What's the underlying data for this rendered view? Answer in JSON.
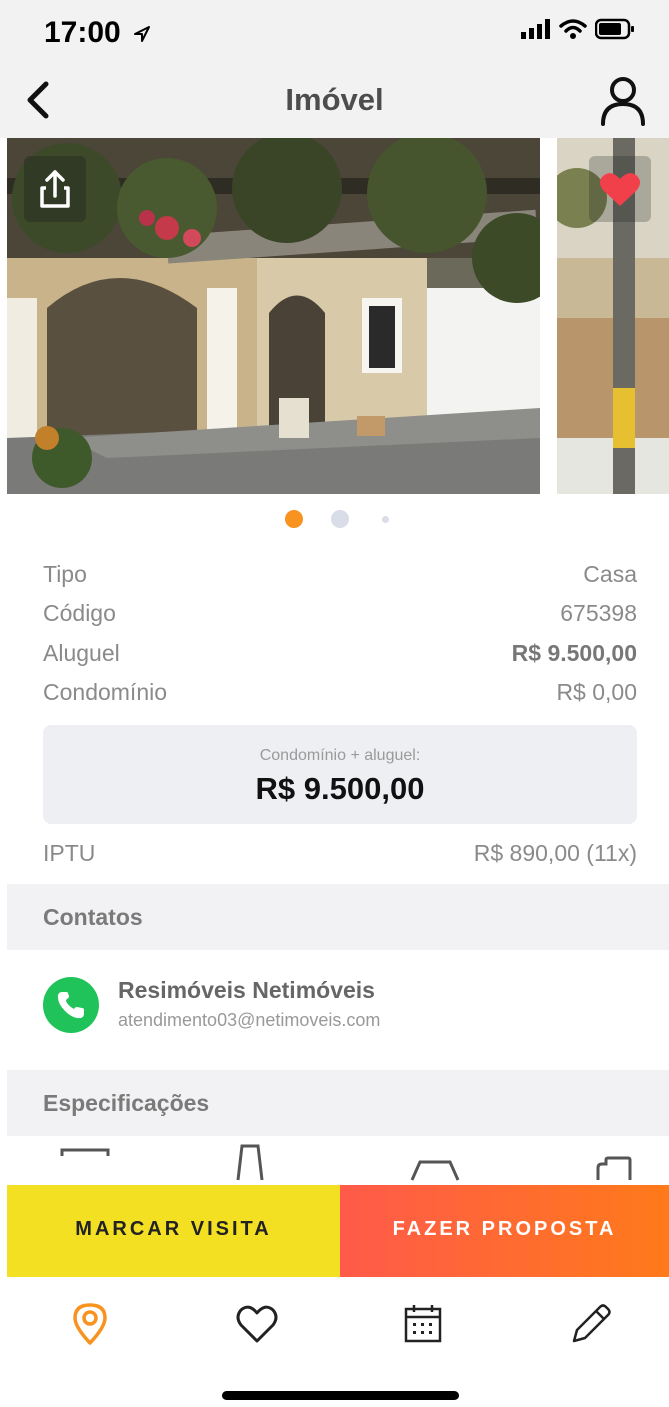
{
  "status_bar": {
    "time": "17:00"
  },
  "nav": {
    "title": "Imóvel"
  },
  "gallery": {
    "dots_count": 3,
    "active_dot": 0
  },
  "details": {
    "rows": [
      {
        "label": "Tipo",
        "value": "Casa",
        "bold": false
      },
      {
        "label": "Código",
        "value": "675398",
        "bold": false
      },
      {
        "label": "Aluguel",
        "value": "R$ 9.500,00",
        "bold": true
      },
      {
        "label": "Condomínio",
        "value": "R$ 0,00",
        "bold": false
      }
    ],
    "total_label": "Condomínio + aluguel:",
    "total_value": "R$ 9.500,00",
    "iptu_label": "IPTU",
    "iptu_value": "R$ 890,00 (11x)"
  },
  "contacts": {
    "header": "Contatos",
    "name": "Resimóveis Netimóveis",
    "email": "atendimento03@netimoveis.com"
  },
  "specs": {
    "header": "Especificações"
  },
  "actions": {
    "visit_label": "MARCAR VISITA",
    "offer_label": "FAZER PROPOSTA"
  },
  "colors": {
    "accent_orange": "#f7931e",
    "visit_yellow": "#f4e022",
    "offer_gradient_start": "#ff5a4a",
    "offer_gradient_end": "#ff7a1a",
    "favorite_red": "#f2404a",
    "phone_green": "#1fc35a"
  },
  "tabs": [
    {
      "icon": "location-pin-icon",
      "active": true
    },
    {
      "icon": "heart-icon",
      "active": false
    },
    {
      "icon": "calendar-icon",
      "active": false
    },
    {
      "icon": "pencil-icon",
      "active": false
    }
  ]
}
